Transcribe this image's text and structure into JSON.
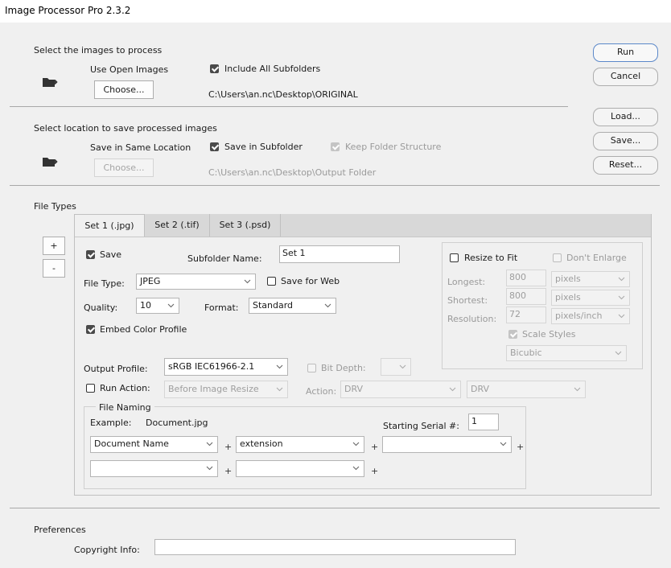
{
  "window": {
    "title": "Image Processor Pro 2.3.2"
  },
  "source": {
    "heading": "Select the images to process",
    "use_open_images_label": "Use Open Images",
    "choose_label": "Choose...",
    "include_subfolders_label": "Include All Subfolders",
    "include_subfolders_checked": true,
    "path": "C:\\Users\\an.nc\\Desktop\\ORIGINAL"
  },
  "destination": {
    "heading": "Select location to save processed images",
    "save_same_location_label": "Save in Same Location",
    "save_in_subfolder_label": "Save in Subfolder",
    "save_in_subfolder_checked": true,
    "keep_structure_label": "Keep Folder Structure",
    "keep_structure_checked": true,
    "choose_label": "Choose...",
    "path": "C:\\Users\\an.nc\\Desktop\\Output Folder"
  },
  "actions": {
    "run": "Run",
    "cancel": "Cancel",
    "load": "Load...",
    "save": "Save...",
    "reset": "Reset..."
  },
  "file_types": {
    "heading": "File Types",
    "add_label": "+",
    "remove_label": "-",
    "tabs": [
      "Set 1 (.jpg)",
      "Set 2 (.tif)",
      "Set 3 (.psd)"
    ],
    "active_tab": 0
  },
  "set": {
    "save_label": "Save",
    "save_checked": true,
    "subfolder_name_label": "Subfolder Name:",
    "subfolder_name_value": "Set 1",
    "file_type_label": "File Type:",
    "file_type_value": "JPEG",
    "save_for_web_label": "Save for Web",
    "save_for_web_checked": false,
    "quality_label": "Quality:",
    "quality_value": "10",
    "format_label": "Format:",
    "format_value": "Standard",
    "embed_profile_label": "Embed Color Profile",
    "embed_profile_checked": true,
    "output_profile_label": "Output Profile:",
    "output_profile_value": "sRGB IEC61966-2.1",
    "bit_depth_label": "Bit Depth:",
    "bit_depth_value": "",
    "run_action_label": "Run Action:",
    "run_action_value": "Before Image Resize",
    "action_label": "Action:",
    "action_set_value": "DRV",
    "action_value": "DRV"
  },
  "resize": {
    "resize_to_fit_label": "Resize to Fit",
    "resize_to_fit_checked": false,
    "dont_enlarge_label": "Don't Enlarge",
    "dont_enlarge_checked": false,
    "longest_label": "Longest:",
    "longest_value": "800",
    "longest_unit": "pixels",
    "shortest_label": "Shortest:",
    "shortest_value": "800",
    "shortest_unit": "pixels",
    "resolution_label": "Resolution:",
    "resolution_value": "72",
    "resolution_unit": "pixels/inch",
    "scale_styles_label": "Scale Styles",
    "scale_styles_checked": true,
    "resample_value": "Bicubic"
  },
  "naming": {
    "heading": "File Naming",
    "example_label": "Example:",
    "example_value": "Document.jpg",
    "starting_serial_label": "Starting Serial #:",
    "starting_serial_value": "1",
    "plus": "+",
    "fields": [
      "Document Name",
      "extension",
      "",
      "",
      ""
    ]
  },
  "preferences": {
    "heading": "Preferences",
    "copyright_label": "Copyright Info:",
    "copyright_value": ""
  }
}
